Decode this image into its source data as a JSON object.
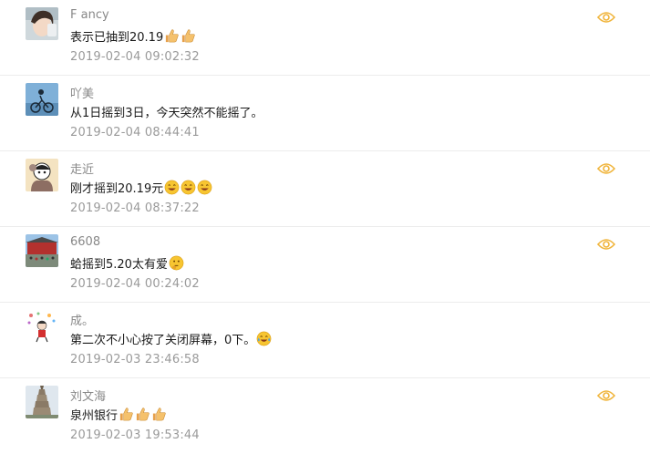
{
  "comments": [
    {
      "name": "F ancy",
      "text": "表示已抽到20.19",
      "emojis": [
        "thumbs-up-emoji",
        "thumbs-up-emoji"
      ],
      "date": "2019-02-04 09:02:32",
      "avatar": "girl-photo-avatar",
      "has_eye": true
    },
    {
      "name": "吖美",
      "text": "从1日摇到3日，今天突然不能摇了。",
      "emojis": [],
      "date": "2019-02-04 08:44:41",
      "avatar": "cyclist-photo-avatar",
      "has_eye": false
    },
    {
      "name": "走近",
      "text": "刚才摇到20.19元",
      "emojis": [
        "laughing-face-emoji",
        "laughing-face-emoji",
        "laughing-face-emoji"
      ],
      "date": "2019-02-04 08:37:22",
      "avatar": "cartoon-avatar",
      "has_eye": true
    },
    {
      "name": "6608",
      "text": "蛤摇到5.20太有爱",
      "emojis": [
        "thinking-face-emoji"
      ],
      "date": "2019-02-04 00:24:02",
      "avatar": "crowd-photo-avatar",
      "has_eye": true
    },
    {
      "name": "成。",
      "text": "第二次不小心按了关闭屏幕，0下。",
      "emojis": [
        "tears-of-joy-emoji"
      ],
      "date": "2019-02-03 23:46:58",
      "avatar": "cartoon-figure-avatar",
      "has_eye": false
    },
    {
      "name": "刘文海",
      "text": "泉州银行",
      "emojis": [
        "thumbs-up-emoji",
        "thumbs-up-emoji",
        "thumbs-up-emoji"
      ],
      "date": "2019-02-03 19:53:44",
      "avatar": "pagoda-photo-avatar",
      "has_eye": true
    }
  ],
  "colors": {
    "accent": "#f0b43a",
    "name": "#888888",
    "date": "#9a9a9a",
    "divider": "#ececec"
  }
}
